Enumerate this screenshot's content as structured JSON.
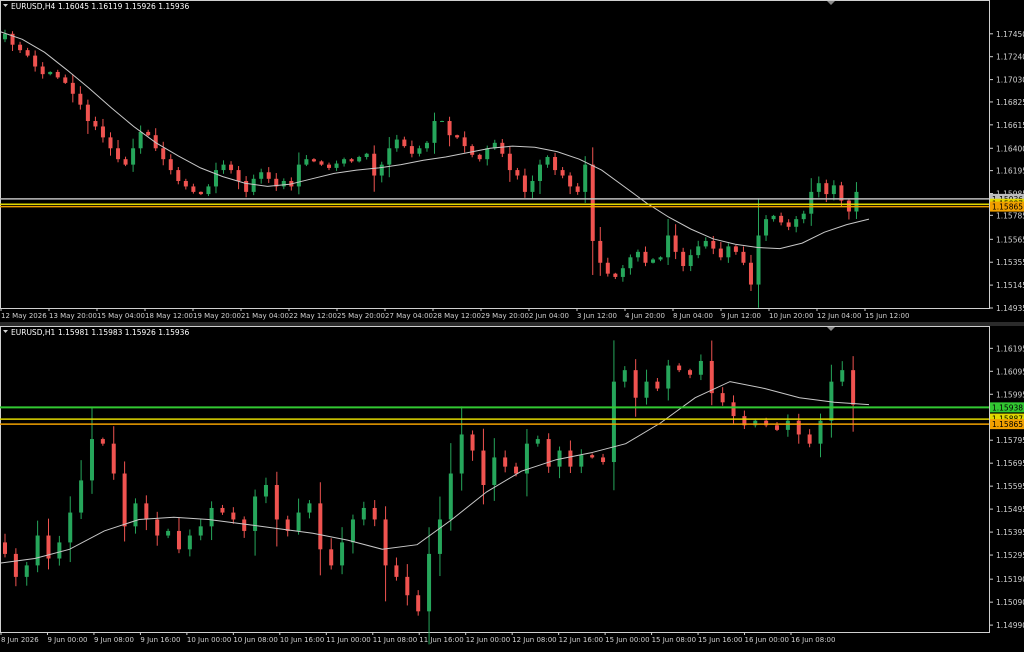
{
  "colors": {
    "bull": "#26a65b",
    "bear": "#ef5350",
    "ma": "#c8c8c8",
    "axis_text": "#d0d0d0",
    "frame": "#d0d0d0",
    "level_orange": "#f0a000",
    "level_yellow": "#e0d800",
    "level_white": "#bdbdbd",
    "level_green": "#32c832"
  },
  "panes": [
    {
      "id": "h4",
      "header": {
        "symbol": "EURUSD,H4",
        "values": "1.16045 1.16119 1.15926 1.15936"
      },
      "y_ticks": [
        "1.17450",
        "1.17240",
        "1.17030",
        "1.16825",
        "1.16615",
        "1.16400",
        "1.16195",
        "1.15985",
        "1.15785",
        "1.15565",
        "1.15355",
        "1.15145",
        "1.14935"
      ],
      "x_ticks": [
        "12 May 2026",
        "13 May 20:00",
        "15 May 04:00",
        "18 May 12:00",
        "19 May 20:00",
        "21 May 04:00",
        "22 May 12:00",
        "25 May 20:00",
        "27 May 04:00",
        "28 May 12:00",
        "29 May 20:00",
        "2 Jun 04:00",
        "3 Jun 12:00",
        "4 Jun 20:00",
        "8 Jun 04:00",
        "9 Jun 12:00",
        "10 Jun 20:00",
        "12 Jun 04:00",
        "15 Jun 12:00"
      ],
      "price_labels": [
        {
          "text": "1.15936",
          "kind": "white"
        },
        {
          "text": "1.15887",
          "kind": "yellow"
        },
        {
          "text": "1.15865",
          "kind": "orange"
        }
      ],
      "chart_data": {
        "type": "candlestick",
        "ylim": [
          1.14935,
          1.1765
        ],
        "levels": [
          {
            "price": 1.15936,
            "style": "white"
          },
          {
            "price": 1.15887,
            "style": "yellow"
          },
          {
            "price": 1.15865,
            "style": "orange"
          }
        ],
        "close_path": [
          1.174,
          1.1745,
          1.1735,
          1.173,
          1.1725,
          1.1715,
          1.1708,
          1.171,
          1.1705,
          1.17,
          1.169,
          1.168,
          1.1665,
          1.166,
          1.165,
          1.164,
          1.163,
          1.1625,
          1.164,
          1.1655,
          1.1652,
          1.164,
          1.163,
          1.162,
          1.161,
          1.1605,
          1.16,
          1.1598,
          1.1605,
          1.162,
          1.1625,
          1.162,
          1.161,
          1.16,
          1.1612,
          1.1618,
          1.1612,
          1.1605,
          1.161,
          1.1605,
          1.1625,
          1.163,
          1.1628,
          1.1625,
          1.1622,
          1.1626,
          1.163,
          1.1628,
          1.1632,
          1.1635,
          1.1615,
          1.1625,
          1.164,
          1.1648,
          1.1642,
          1.1635,
          1.164,
          1.1645,
          1.1665,
          1.1665,
          1.1652,
          1.165,
          1.1642,
          1.1634,
          1.163,
          1.164,
          1.1645,
          1.1635,
          1.162,
          1.1615,
          1.16,
          1.161,
          1.1625,
          1.1632,
          1.162,
          1.1615,
          1.1605,
          1.16,
          1.1625,
          1.1555,
          1.1535,
          1.1525,
          1.1522,
          1.153,
          1.154,
          1.1545,
          1.1535,
          1.1538,
          1.154,
          1.156,
          1.1545,
          1.1532,
          1.1542,
          1.155,
          1.1555,
          1.1548,
          1.154,
          1.155,
          1.1545,
          1.1535,
          1.1515,
          1.156,
          1.1575,
          1.1578,
          1.1572,
          1.1568,
          1.1575,
          1.158,
          1.16,
          1.1608,
          1.1598,
          1.1606,
          1.1592,
          1.1582,
          1.16
        ],
        "ma_path": [
          1.1747,
          1.174,
          1.1728,
          1.1712,
          1.1695,
          1.1677,
          1.166,
          1.1645,
          1.1633,
          1.1622,
          1.1614,
          1.1608,
          1.1605,
          1.1607,
          1.1612,
          1.1617,
          1.162,
          1.1622,
          1.1625,
          1.1629,
          1.1632,
          1.1636,
          1.164,
          1.1642,
          1.1641,
          1.1637,
          1.163,
          1.162,
          1.1605,
          1.159,
          1.1577,
          1.1566,
          1.1557,
          1.1552,
          1.1549,
          1.1548,
          1.1553,
          1.1563,
          1.157,
          1.1575
        ]
      }
    },
    {
      "id": "h1",
      "header": {
        "symbol": "EURUSD,H1",
        "values": "1.15981 1.15983 1.15926 1.15936"
      },
      "y_ticks": [
        "1.16195",
        "1.16095",
        "1.15995",
        "1.15895",
        "1.15795",
        "1.15695",
        "1.15595",
        "1.15495",
        "1.15395",
        "1.15295",
        "1.15190",
        "1.15090",
        "1.14990"
      ],
      "x_ticks": [
        "8 Jun 2026",
        "9 Jun 00:00",
        "9 Jun 08:00",
        "9 Jun 16:00",
        "10 Jun 00:00",
        "10 Jun 08:00",
        "10 Jun 16:00",
        "11 Jun 00:00",
        "11 Jun 08:00",
        "11 Jun 16:00",
        "12 Jun 00:00",
        "12 Jun 08:00",
        "12 Jun 16:00",
        "15 Jun 00:00",
        "15 Jun 08:00",
        "15 Jun 16:00",
        "16 Jun 00:00",
        "16 Jun 08:00"
      ],
      "price_labels": [
        {
          "text": "1.15938",
          "kind": "green"
        },
        {
          "text": "1.15887",
          "kind": "yellow"
        },
        {
          "text": "1.15865",
          "kind": "orange"
        }
      ],
      "chart_data": {
        "type": "candlestick",
        "ylim": [
          1.1496,
          1.1624
        ],
        "levels": [
          {
            "price": 1.15938,
            "style": "green"
          },
          {
            "price": 1.15887,
            "style": "yellow"
          },
          {
            "price": 1.15865,
            "style": "orange"
          }
        ],
        "close_path": [
          1.1535,
          1.153,
          1.152,
          1.1525,
          1.1538,
          1.1528,
          1.1535,
          1.1548,
          1.1562,
          1.158,
          1.1578,
          1.1565,
          1.1542,
          1.1552,
          1.1545,
          1.1538,
          1.154,
          1.1532,
          1.1538,
          1.1542,
          1.155,
          1.1548,
          1.1545,
          1.154,
          1.1555,
          1.156,
          1.1545,
          1.154,
          1.1548,
          1.1552,
          1.1532,
          1.1525,
          1.1535,
          1.1545,
          1.155,
          1.1545,
          1.1525,
          1.152,
          1.1512,
          1.1505,
          1.153,
          1.1545,
          1.1565,
          1.1582,
          1.1575,
          1.156,
          1.1572,
          1.1568,
          1.1565,
          1.1578,
          1.158,
          1.1568,
          1.1575,
          1.1568,
          1.1573,
          1.1572,
          1.157,
          1.1605,
          1.161,
          1.1598,
          1.1605,
          1.1602,
          1.1612,
          1.161,
          1.1608,
          1.1614,
          1.16,
          1.1596,
          1.159,
          1.1586,
          1.1588,
          1.1586,
          1.1584,
          1.1588,
          1.1582,
          1.1578,
          1.1588,
          1.1605,
          1.161,
          1.1595
        ],
        "ma_path": [
          1.1526,
          1.1528,
          1.1532,
          1.154,
          1.1545,
          1.1546,
          1.1545,
          1.1543,
          1.1541,
          1.1539,
          1.1536,
          1.1532,
          1.1534,
          1.1545,
          1.1557,
          1.1566,
          1.1571,
          1.1574,
          1.1578,
          1.1587,
          1.1598,
          1.1605,
          1.1602,
          1.1598,
          1.1596,
          1.1595
        ]
      }
    }
  ]
}
